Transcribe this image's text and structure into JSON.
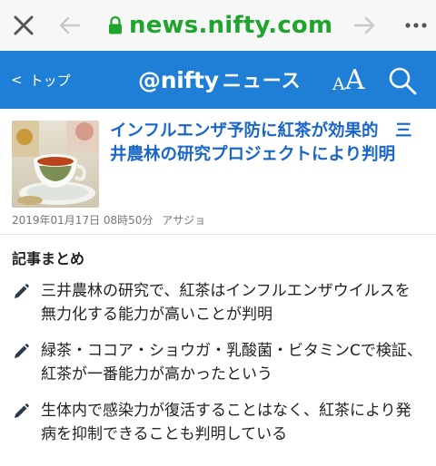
{
  "browser": {
    "domain": "news.nifty.com",
    "colors": {
      "domain": "#1fa52e",
      "icons": "#555555"
    }
  },
  "header": {
    "back_label": "トップ",
    "logo_text": "@nifty",
    "logo_suffix": "ニュース",
    "font_size_label": "AA",
    "background": "#1f7fd6"
  },
  "article": {
    "title": "インフルエンザ予防に紅茶が効果的　三井農林の研究プロジェクトにより判明",
    "date": "2019年01月17日 08時50分",
    "source": "アサジョ",
    "title_color": "#1a66c8"
  },
  "summary": {
    "heading": "記事まとめ",
    "items": [
      "三井農林の研究で、紅茶はインフルエンザウイルスを無力化する能力が高いことが判明",
      "緑茶・ココア・ショウガ・乳酸菌・ビタミンCで検証、紅茶が一番能力が高かったという",
      "生体内で感染力が復活することはなく、紅茶により発病を抑制できることも判明している"
    ]
  }
}
